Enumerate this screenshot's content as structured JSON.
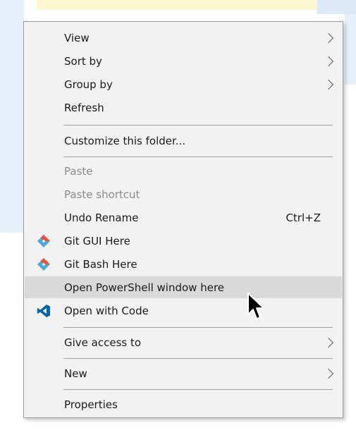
{
  "context_menu": {
    "items": [
      {
        "label": "View",
        "has_submenu": true,
        "disabled": false
      },
      {
        "label": "Sort by",
        "has_submenu": true,
        "disabled": false
      },
      {
        "label": "Group by",
        "has_submenu": true,
        "disabled": false
      },
      {
        "label": "Refresh",
        "has_submenu": false,
        "disabled": false
      },
      {
        "label": "Customize this folder...",
        "has_submenu": false,
        "disabled": false
      },
      {
        "label": "Paste",
        "has_submenu": false,
        "disabled": true
      },
      {
        "label": "Paste shortcut",
        "has_submenu": false,
        "disabled": true
      },
      {
        "label": "Undo Rename",
        "shortcut": "Ctrl+Z",
        "has_submenu": false,
        "disabled": false
      },
      {
        "label": "Git GUI Here",
        "icon": "git-icon",
        "has_submenu": false,
        "disabled": false
      },
      {
        "label": "Git Bash Here",
        "icon": "git-icon",
        "has_submenu": false,
        "disabled": false
      },
      {
        "label": "Open PowerShell window here",
        "highlighted": true,
        "has_submenu": false,
        "disabled": false
      },
      {
        "label": "Open with Code",
        "icon": "vscode-icon",
        "has_submenu": false,
        "disabled": false
      },
      {
        "label": "Give access to",
        "has_submenu": true,
        "disabled": false
      },
      {
        "label": "New",
        "has_submenu": true,
        "disabled": false
      },
      {
        "label": "Properties",
        "has_submenu": false,
        "disabled": false
      }
    ]
  },
  "colors": {
    "menu_background": "#f2f2f2",
    "highlight": "#d9d9d9",
    "disabled_text": "#8a8a8a",
    "git_orange": "#f05133",
    "git_blue": "#4aa8dc",
    "vscode_blue": "#0065a9"
  }
}
